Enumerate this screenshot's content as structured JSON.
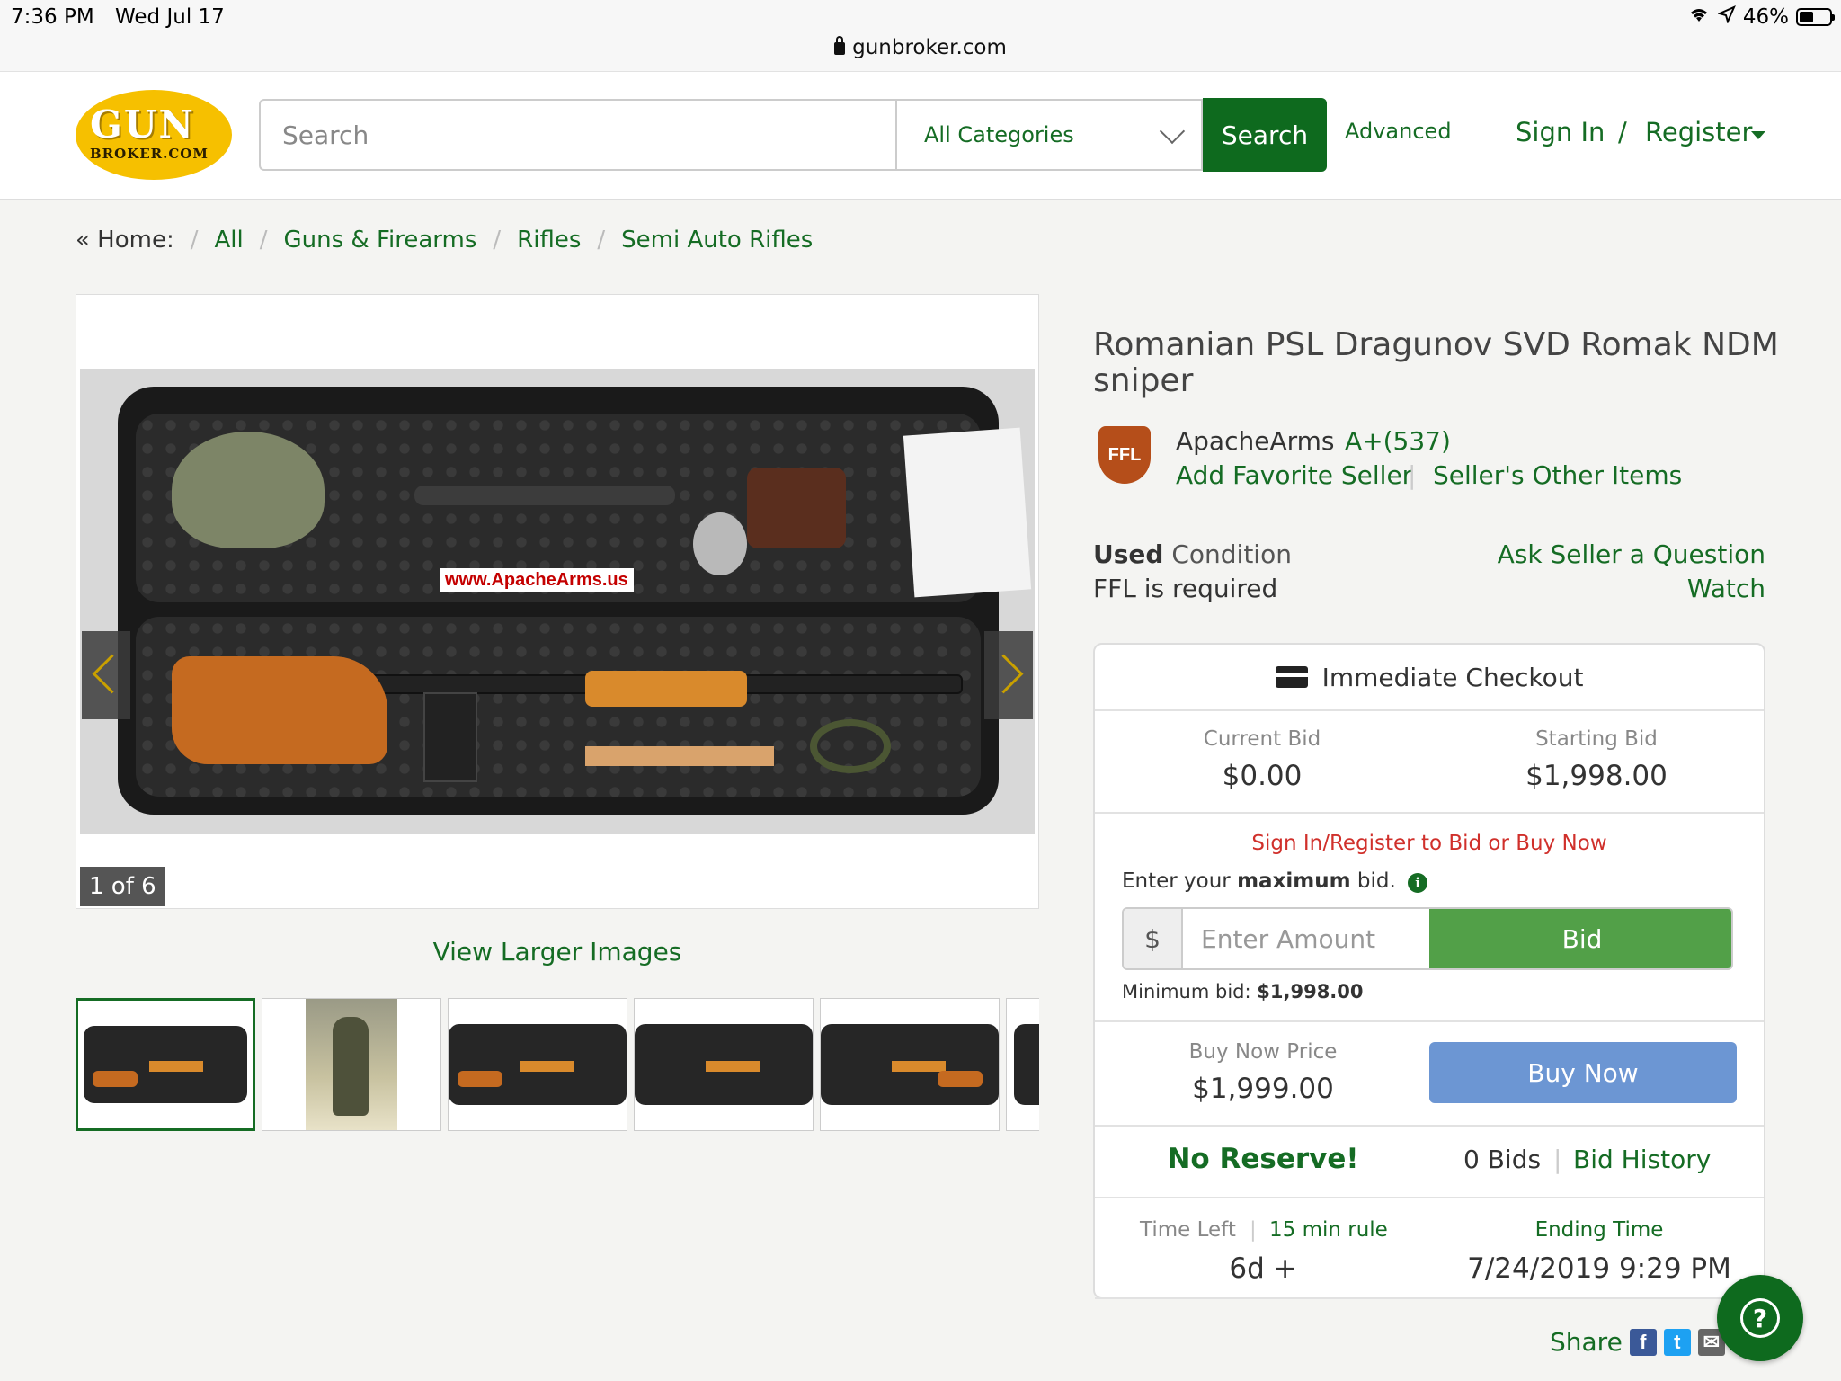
{
  "status_bar": {
    "time": "7:36 PM",
    "date": "Wed Jul 17",
    "url": "gunbroker.com",
    "battery": "46%",
    "battery_level": 0.46
  },
  "header": {
    "logo_top": "GUN",
    "logo_bottom": "BROKER.COM",
    "search_placeholder": "Search",
    "category": "All Categories",
    "search_button": "Search",
    "advanced": "Advanced",
    "sign_in": "Sign In",
    "separator": "/",
    "register": "Register"
  },
  "breadcrumb": {
    "home": "« Home:",
    "items": [
      "All",
      "Guns & Firearms",
      "Rifles",
      "Semi Auto Rifles"
    ]
  },
  "gallery": {
    "watermark": "www.ApacheArms.us",
    "counter": "1 of 6",
    "view_larger": "View Larger Images",
    "thumbnail_count": 6
  },
  "listing": {
    "title": "Romanian PSL Dragunov SVD Romak NDM sniper",
    "ffl_badge": "FFL",
    "seller": "ApacheArms",
    "rating": "A+(537)",
    "add_favorite": "Add Favorite Seller",
    "other_items": "Seller's Other Items",
    "condition_value": "Used",
    "condition_label": "Condition",
    "ffl_required": "FFL is required",
    "ask_seller": "Ask Seller a Question",
    "watch": "Watch"
  },
  "panel": {
    "checkout": "Immediate Checkout",
    "current_bid_label": "Current Bid",
    "current_bid": "$0.00",
    "starting_bid_label": "Starting Bid",
    "starting_bid": "$1,998.00",
    "signin_prompt": "Sign In/Register to Bid or Buy Now",
    "enter_your": "Enter your",
    "maximum": "maximum",
    "bid_suffix": "bid.",
    "currency": "$",
    "amount_placeholder": "Enter Amount",
    "bid_button": "Bid",
    "min_bid_label": "Minimum bid:",
    "min_bid": "$1,998.00",
    "buy_now_label": "Buy Now Price",
    "buy_now_price": "$1,999.00",
    "buy_now_button": "Buy Now",
    "no_reserve": "No Reserve!",
    "bids_count": "0 Bids",
    "bid_history": "Bid History",
    "time_left_label": "Time Left",
    "rule_15": "15 min rule",
    "time_left": "6d +",
    "ending_label": "Ending Time",
    "ending_time": "7/24/2019 9:29 PM"
  },
  "share": {
    "label": "Share",
    "facebook": "f",
    "twitter": "t",
    "email": "✉"
  },
  "help": "?",
  "colors": {
    "brand_green": "#0e6a1e",
    "link_green": "#156c24",
    "bid_green": "#52a048",
    "buy_blue": "#6c96d3",
    "alert_red": "#d0302b",
    "logo_yellow": "#f6c000"
  }
}
